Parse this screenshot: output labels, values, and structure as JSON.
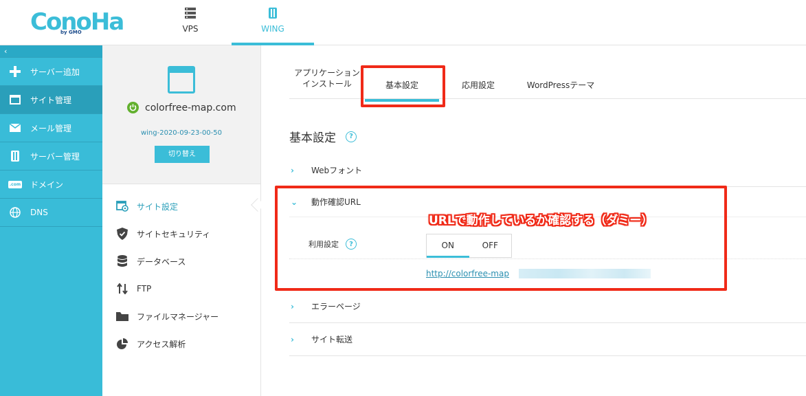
{
  "logo": {
    "text": "ConoHa",
    "by": "by GMO"
  },
  "topnav": [
    {
      "label": "VPS",
      "icon": "server-icon"
    },
    {
      "label": "WING",
      "icon": "wing-icon"
    }
  ],
  "sidebar": {
    "collapse": "‹",
    "items": [
      {
        "label": "サーバー追加",
        "icon": "plus-icon"
      },
      {
        "label": "サイト管理",
        "icon": "window-icon"
      },
      {
        "label": "メール管理",
        "icon": "mail-icon"
      },
      {
        "label": "サーバー管理",
        "icon": "server-icon"
      },
      {
        "label": "ドメイン",
        "icon": "domain-icon",
        "badge": ".com"
      },
      {
        "label": "DNS",
        "icon": "globe-icon"
      }
    ]
  },
  "site": {
    "name": "colorfree-map.com",
    "wing_id": "wing-2020-09-23-00-50",
    "switch_label": "切り替え"
  },
  "menu": [
    {
      "label": "サイト設定",
      "icon": "site-settings-icon"
    },
    {
      "label": "サイトセキュリティ",
      "icon": "shield-icon"
    },
    {
      "label": "データベース",
      "icon": "database-icon"
    },
    {
      "label": "FTP",
      "icon": "ftp-icon"
    },
    {
      "label": "ファイルマネージャー",
      "icon": "folder-icon"
    },
    {
      "label": "アクセス解析",
      "icon": "pie-chart-icon"
    }
  ],
  "tabs": [
    {
      "label_line1": "アプリケーション",
      "label_line2": "インストール"
    },
    {
      "label": "基本設定"
    },
    {
      "label": "応用設定"
    },
    {
      "label": "WordPressテーマ"
    }
  ],
  "section": {
    "title": "基本設定",
    "help": "?"
  },
  "accordions": [
    {
      "label": "Webフォント",
      "chevron": "›"
    },
    {
      "label": "動作確認URL",
      "chevron": "⌄"
    },
    {
      "label": "エラーページ",
      "chevron": "›"
    },
    {
      "label": "サイト転送",
      "chevron": "›"
    }
  ],
  "setting": {
    "label": "利用設定",
    "help": "?",
    "toggle_on": "ON",
    "toggle_off": "OFF",
    "url": "http://colorfree-map"
  },
  "annotation": "URLで動作しているか確認する（ダミー）",
  "colors": {
    "accent": "#3bbdd8",
    "highlight": "#f02a18",
    "sidebar": "#39bcd8"
  }
}
